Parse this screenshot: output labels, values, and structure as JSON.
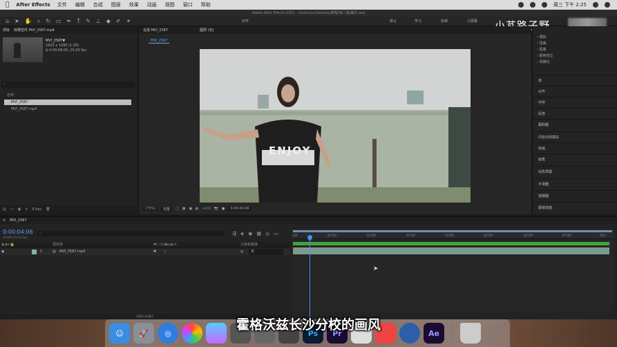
{
  "menubar": {
    "app_name": "After Effects",
    "items": [
      "文件",
      "编辑",
      "合成",
      "图层",
      "效果",
      "动画",
      "视图",
      "窗口",
      "帮助"
    ],
    "clock": "周三 下午 2:25"
  },
  "window_title": "Adobe After Effects 2021 - /Users/yy/Desktop/教程/第二篇/魔法.aep",
  "toolbar": {
    "align_label": "对齐",
    "workspaces": [
      "默认",
      "学习",
      "标准",
      "小屏幕"
    ]
  },
  "watermark": "小芃路子野",
  "project": {
    "tab_label": "项目",
    "effects_tab": "效果控件 MVI_2587.mp4",
    "item_name": "MVI_2587▼",
    "item_size": "1920 x 1080 (1.00)",
    "item_duration": "Δ 0:00:08:00, 25.00 fps",
    "col_name": "名称",
    "rows": [
      "MVI_2587",
      "MVI_2587.mp4"
    ],
    "bpc": "8 bpc"
  },
  "viewer": {
    "tab_label": "合成 MVI_2587",
    "layer_tab": "图层 (无)",
    "sub_tab": "MVI_2587",
    "zoom": "(73%)",
    "quality": "完整",
    "exposure": "+0.0",
    "timecode": "0:00:04:06",
    "shirt_text": "ENJOY"
  },
  "right_panel": {
    "tree": [
      "模拟",
      "扭曲",
      "抠像",
      "颜色校正",
      "风格化"
    ],
    "sections": [
      "库",
      "对齐",
      "字符",
      "段落",
      "跟踪器",
      "内容识别填充",
      "绘画",
      "画笔",
      "动态草图",
      "平滑器",
      "摇摆器",
      "蒙版插值"
    ]
  },
  "timeline": {
    "tab_label": "MVI_2587",
    "timecode": "0:00:04:06",
    "frame_info": "00106 (25.00 fps)",
    "col_source": "源名称",
    "col_parent": "父级和链接",
    "layer_index": "1",
    "layer_name": "MVI_2587.mp4",
    "parent_value": "无",
    "ticks": [
      "00f",
      "01:00f",
      "02:00f",
      "03:00f",
      "04:00f",
      "05:00f",
      "06:00f",
      "07:00f",
      "08:0"
    ],
    "bottom_label": "切换开关/模式"
  },
  "dock_icons": [
    "Ps",
    "Pr",
    "Ae"
  ],
  "subtitle": "霍格沃兹长沙分校的画风"
}
